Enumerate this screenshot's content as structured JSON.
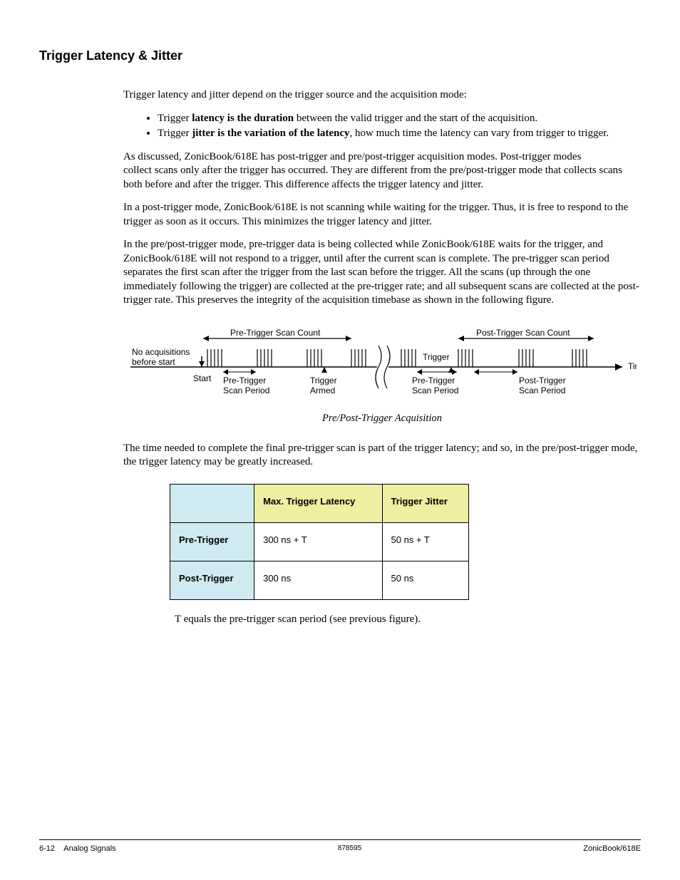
{
  "section_title": "Trigger Latency & Jitter",
  "intro": "Trigger latency and jitter depend on the trigger source and the acquisition mode:",
  "bullets": [
    {
      "prefix": "Trigger ",
      "bold": "latency is the duration",
      "suffix": " between the valid trigger and the start of the acquisition."
    },
    {
      "prefix": "Trigger ",
      "bold": "jitter is the variation of the latency",
      "suffix": ", how much time the latency can vary from trigger to trigger."
    }
  ],
  "para1a": "As discussed, ZonicBook/618E has post-trigger and pre/post-trigger acquisition modes.  Post-trigger modes",
  "para1b": "collect scans only after the trigger has occurred.  They are different from the pre/post-trigger mode that collects scans both before and after the trigger.  This difference affects the trigger latency and jitter.",
  "para2": "In a post-trigger mode, ZonicBook/618E is not scanning while waiting for the trigger.  Thus, it is free to respond to the trigger as soon as it occurs.  This minimizes the trigger latency and jitter.",
  "para3": "In the pre/post-trigger mode, pre-trigger data is being collected while ZonicBook/618E waits for the trigger, and ZonicBook/618E will not respond to a trigger, until after the current scan is complete.  The pre-trigger scan period separates the first scan after the trigger from the last scan before the trigger.  All the scans (up through the one immediately following the trigger) are collected at the pre-trigger rate; and all subsequent scans are collected at the post-trigger rate.  This preserves the integrity of the acquisition timebase as shown in the following figure.",
  "figure": {
    "caption": "Pre/Post-Trigger Acquisition",
    "labels": {
      "no_acq": "No acquisitions",
      "before_start": "before start",
      "start": "Start",
      "pre_scan_count": "Pre-Trigger Scan Count",
      "post_scan_count": "Post-Trigger Scan Count",
      "pre_scan_period": "Pre-Trigger",
      "scan_period_line2": "Scan Period",
      "trigger_armed": "Trigger",
      "armed_line2": "Armed",
      "trigger": "Trigger",
      "post_scan_period": "Post-Trigger",
      "time": "Time"
    }
  },
  "para4": "The time needed to complete the final pre-trigger scan is part of the trigger latency; and so, in the pre/post-trigger mode, the trigger latency may be greatly increased.",
  "table": {
    "headers": {
      "col1": "Max. Trigger Latency",
      "col2": "Trigger Jitter"
    },
    "rows": [
      {
        "label": "Pre-Trigger",
        "latency": "300 ns + T",
        "jitter": "50 ns + T"
      },
      {
        "label": "Post-Trigger",
        "latency": "300 ns",
        "jitter": "50 ns"
      }
    ]
  },
  "table_note": "T equals the pre-trigger scan period (see previous figure).",
  "footer": {
    "left_page": "6-12",
    "left_label": "Analog Signals",
    "center": "878595",
    "right": "ZonicBook/618E"
  }
}
